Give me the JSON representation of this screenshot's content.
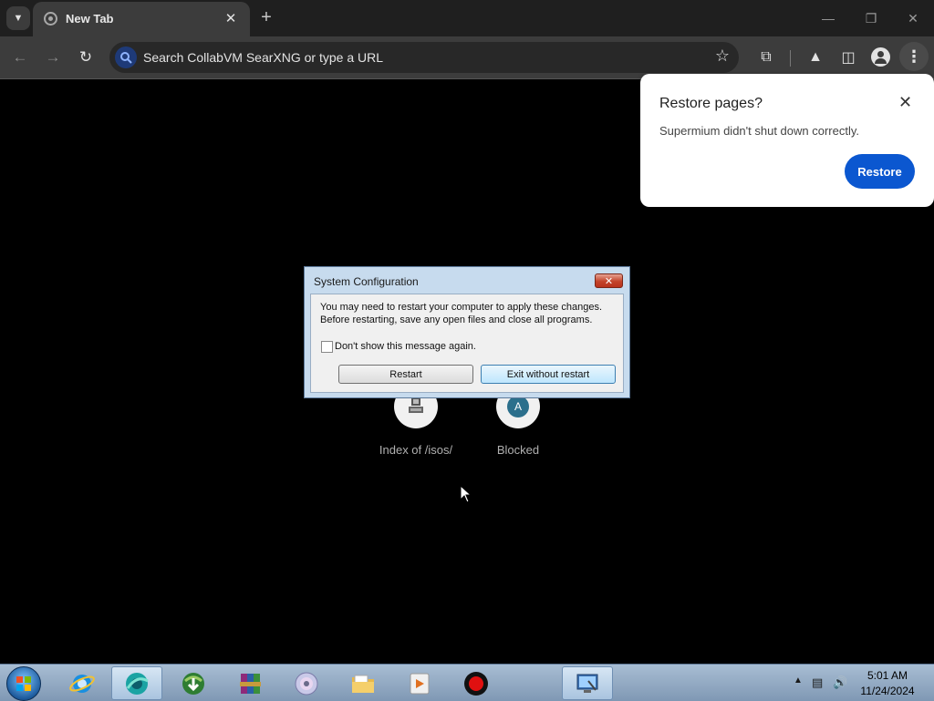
{
  "browser": {
    "tab": {
      "title": "New Tab"
    },
    "omnibox": {
      "placeholder": "Search CollabVM SearXNG or type a URL"
    }
  },
  "restore_popup": {
    "title": "Restore pages?",
    "message": "Supermium didn't shut down correctly.",
    "restore_label": "Restore",
    "accent_color": "#0b57d0"
  },
  "shortcuts": [
    {
      "label": "Index of /isos/",
      "icon": "computer-icon"
    },
    {
      "label": "Blocked",
      "icon": "letter-a-icon",
      "letter": "A"
    }
  ],
  "dialog": {
    "title": "System Configuration",
    "message_line1": "You may need to restart your computer to apply these changes.",
    "message_line2": "Before restarting, save any open files and close all programs.",
    "checkbox_label": "Don't show this message again.",
    "checkbox_checked": false,
    "restart_label": "Restart",
    "exit_label": "Exit without restart"
  },
  "taskbar": {
    "apps": [
      "internet-explorer-icon",
      "supermium-browser-icon",
      "download-manager-icon",
      "winrar-icon",
      "disc-icon",
      "file-explorer-icon",
      "media-player-icon",
      "record-icon",
      "system-configuration-icon"
    ],
    "clock": {
      "time": "5:01 AM",
      "date": "11/24/2024"
    }
  }
}
